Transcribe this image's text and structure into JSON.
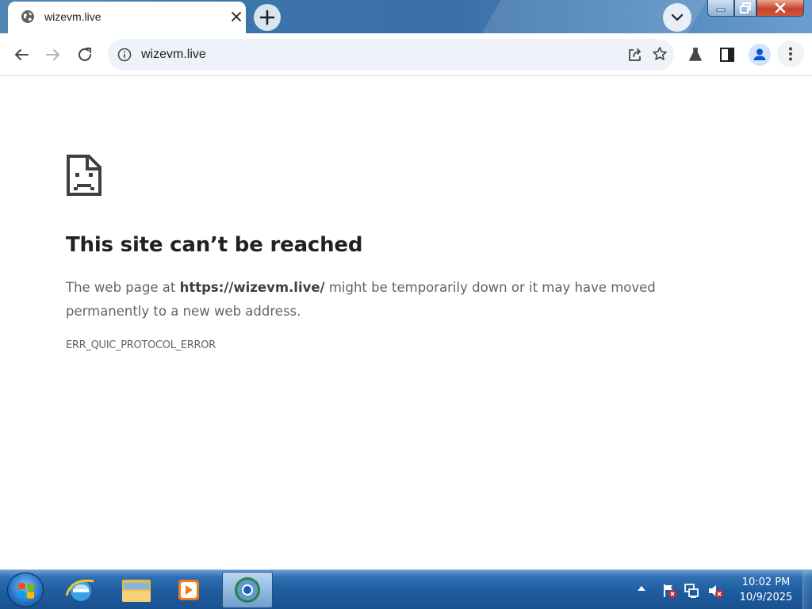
{
  "browser": {
    "tab": {
      "title": "wizevm.live",
      "favicon": "globe-icon"
    },
    "omnibox": {
      "url": "wizevm.live"
    },
    "icons": {
      "back": "arrow-left-icon",
      "forward": "arrow-right-icon",
      "reload": "reload-icon",
      "site_info": "info-icon",
      "share": "share-icon",
      "bookmark": "star-icon",
      "labs": "flask-icon",
      "side_panel": "side-panel-icon",
      "profile": "person-icon",
      "menu": "kebab-menu-icon"
    },
    "colors": {
      "accent": "#0b57d0",
      "text": "#202124",
      "secondary_text": "#5f6368"
    }
  },
  "error_page": {
    "title": "This site can’t be reached",
    "desc_prefix": "The web page at ",
    "desc_url": "https://wizevm.live/",
    "desc_suffix": " might be temporarily down or it may have moved permanently to a new web address.",
    "code": "ERR_QUIC_PROTOCOL_ERROR"
  },
  "taskbar": {
    "clock_time": "10:02 PM",
    "clock_date": "10/9/2025",
    "pinned": [
      "internet-explorer-icon",
      "file-explorer-icon",
      "media-player-icon",
      "chrome-icon"
    ]
  }
}
